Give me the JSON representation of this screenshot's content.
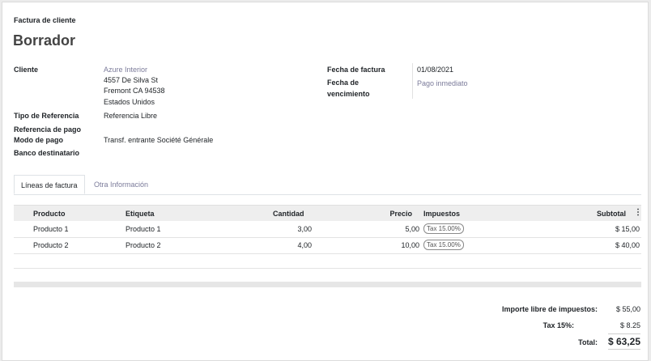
{
  "header": {
    "doc_type": "Factura de cliente",
    "status_title": "Borrador"
  },
  "customer": {
    "label": "Cliente",
    "name": "Azure Interior",
    "address_line1": "4557 De Silva St",
    "address_line2": "Fremont CA 94538",
    "address_line3": "Estados Unidos"
  },
  "invoice_date": {
    "label": "Fecha de factura",
    "value": "01/08/2021"
  },
  "due_date": {
    "label_line1": "Fecha de",
    "label_line2": "vencimiento",
    "value": "Pago inmediato"
  },
  "reference_type": {
    "label": "Tipo de Referencia",
    "value": "Referencia Libre"
  },
  "payment_reference": {
    "label": "Referencia de pago"
  },
  "payment_mode": {
    "label": "Modo de pago",
    "value": "Transf. entrante Société Générale"
  },
  "bank": {
    "label": "Banco destinatario"
  },
  "tabs": [
    {
      "label": "Líneas de factura",
      "active": true
    },
    {
      "label": "Otra Información",
      "active": false
    }
  ],
  "table": {
    "columns": [
      "Producto",
      "Etiqueta",
      "Cantidad",
      "Precio",
      "Impuestos",
      "Subtotal"
    ],
    "rows": [
      {
        "product": "Producto 1",
        "label": "Producto 1",
        "qty": "3,00",
        "price": "5,00",
        "tax": "Tax 15.00%",
        "subtotal": "$ 15,00"
      },
      {
        "product": "Producto 2",
        "label": "Producto 2",
        "qty": "4,00",
        "price": "10,00",
        "tax": "Tax 15.00%",
        "subtotal": "$ 40,00"
      }
    ]
  },
  "totals": {
    "untaxed_label": "Importe libre de impuestos:",
    "untaxed_value": "$ 55,00",
    "tax_label": "Tax 15%:",
    "tax_value": "$ 8.25",
    "total_label": "Total:",
    "total_value": "$ 63,25"
  },
  "colors": {
    "link": "#7b7b9a",
    "header_bg": "#eeeeee"
  },
  "icons": {
    "column_options": "vertical-dots-icon"
  }
}
